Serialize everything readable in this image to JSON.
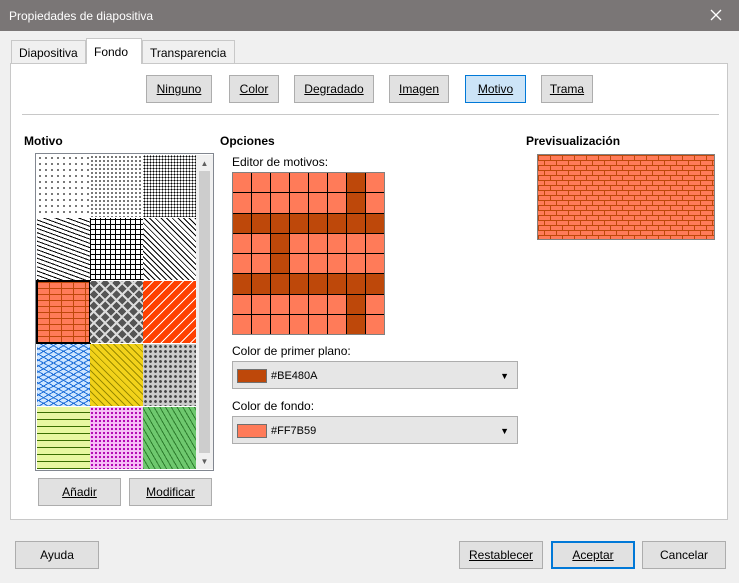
{
  "window": {
    "title": "Propiedades de diapositiva"
  },
  "tabs": [
    {
      "label": "Diapositiva"
    },
    {
      "label": "Fondo"
    },
    {
      "label": "Transparencia"
    }
  ],
  "fill_types": [
    {
      "label": "Ninguno"
    },
    {
      "label": "Color"
    },
    {
      "label": "Degradado"
    },
    {
      "label": "Imagen"
    },
    {
      "label": "Motivo",
      "selected": true
    },
    {
      "label": "Trama"
    }
  ],
  "motivo": {
    "heading": "Motivo",
    "add_label": "Añadir",
    "modify_label": "Modificar",
    "swatches": [
      {
        "name": "puntos-5",
        "fg": "#000000",
        "bg": "#ffffff"
      },
      {
        "name": "puntos-10",
        "fg": "#000000",
        "bg": "#ffffff"
      },
      {
        "name": "puntos-20",
        "fg": "#000000",
        "bg": "#ffffff"
      },
      {
        "name": "zigzag",
        "fg": "#000000",
        "bg": "#ffffff"
      },
      {
        "name": "cuadricula",
        "fg": "#000000",
        "bg": "#ffffff"
      },
      {
        "name": "diagonal",
        "fg": "#000000",
        "bg": "#ffffff"
      },
      {
        "name": "ladrillos",
        "fg": "#be480a",
        "bg": "#ff7b59",
        "selected": true
      },
      {
        "name": "tejido",
        "fg": "#dddddd",
        "bg": "#555555"
      },
      {
        "name": "tejas",
        "fg": "#ffffff",
        "bg": "#ff4000"
      },
      {
        "name": "ondas",
        "fg": "#1e6fd9",
        "bg": "#cfe6ff"
      },
      {
        "name": "cesta",
        "fg": "#9a8a00",
        "bg": "#f2d21a"
      },
      {
        "name": "escamas",
        "fg": "#444444",
        "bg": "#cccccc"
      },
      {
        "name": "guiones",
        "fg": "#3a6e00",
        "bg": "#e8f7a0"
      },
      {
        "name": "confeti",
        "fg": "#b000b0",
        "bg": "#f6c0f6"
      },
      {
        "name": "cesped",
        "fg": "#2e7d2e",
        "bg": "#6ec86e"
      }
    ]
  },
  "opciones": {
    "heading": "Opciones",
    "editor_label": "Editor de motivos:",
    "grid": [
      [
        0,
        0,
        0,
        0,
        0,
        0,
        1,
        0
      ],
      [
        0,
        0,
        0,
        0,
        0,
        0,
        1,
        0
      ],
      [
        1,
        1,
        1,
        1,
        1,
        1,
        1,
        1
      ],
      [
        0,
        0,
        1,
        0,
        0,
        0,
        0,
        0
      ],
      [
        0,
        0,
        1,
        0,
        0,
        0,
        0,
        0
      ],
      [
        1,
        1,
        1,
        1,
        1,
        1,
        1,
        1
      ],
      [
        0,
        0,
        0,
        0,
        0,
        0,
        1,
        0
      ],
      [
        0,
        0,
        0,
        0,
        0,
        0,
        1,
        0
      ]
    ],
    "foreground": {
      "label": "Color de primer plano:",
      "value": "#BE480A",
      "color": "#be480a"
    },
    "background": {
      "label": "Color de fondo:",
      "value": "#FF7B59",
      "color": "#ff7b59"
    }
  },
  "preview": {
    "heading": "Previsualización"
  },
  "footer": {
    "help_label": "Ayuda",
    "reset_label": "Restablecer",
    "ok_label": "Aceptar",
    "cancel_label": "Cancelar"
  }
}
